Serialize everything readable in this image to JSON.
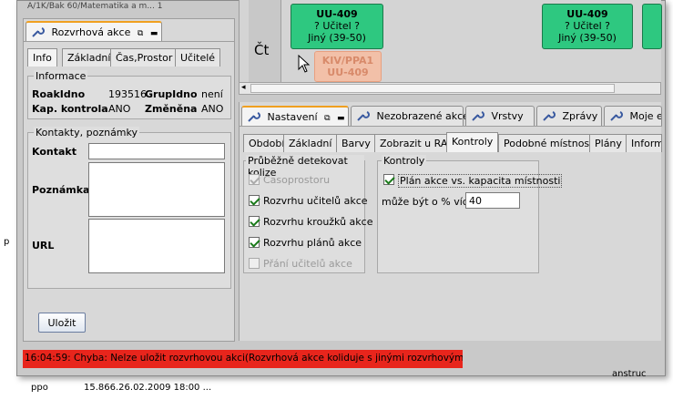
{
  "background": {
    "top_left_fragment": "A/1K/Bak 60/Matematika a m... 1",
    "left_fragment": "p",
    "right_fragment": "anstruc",
    "bottom_fragment": "15.866.26.02.2009 18:00 ...",
    "bottom_left_fragment": "ppo"
  },
  "left_panel": {
    "main_tab": "Rozvrhová akce",
    "tabs": [
      "Info",
      "Základní",
      "Čas,Prostor",
      "Učitelé"
    ],
    "info_group": {
      "title": "Informace",
      "roakidno_label": "RoakIdno",
      "roakidno_value": "193516",
      "grupidno_label": "GrupIdno",
      "grupidno_value": "není",
      "kap_label": "Kap. kontrola",
      "kap_value": "ANO",
      "zmenena_label": "Změněna",
      "zmenena_value": "ANO"
    },
    "contacts_group": {
      "title": "Kontakty, poznámky",
      "kontakt_label": "Kontakt",
      "poznamka_label": "Poznámka",
      "url_label": "URL"
    },
    "save_button": "Uložit"
  },
  "schedule": {
    "day_label": "Čt",
    "event1": {
      "room": "UU-409",
      "teacher": "? Učitel ?",
      "type": "Jiný (39-50)"
    },
    "event2": {
      "room": "UU-409",
      "teacher": "? Učitel ?",
      "type": "Jiný (39-50)"
    },
    "ghost_event": {
      "code": "KIV/PPA1",
      "room": "UU-409"
    }
  },
  "right_panel": {
    "main_tabs": [
      "Nastavení",
      "Nezobrazené akce",
      "Vrstvy",
      "Zprávy",
      "Moje en"
    ],
    "sub_tabs": [
      "Období",
      "Základní",
      "Barvy",
      "Zobrazit u RA",
      "Kontroly",
      "Podobné místnosti",
      "Plány",
      "Inform"
    ],
    "collision_group": {
      "title": "Průběžně detekovat kolize",
      "items": [
        {
          "label": "Časoprostoru",
          "checked": true,
          "disabled": true
        },
        {
          "label": "Rozvrhu učitelů akce",
          "checked": true,
          "disabled": false
        },
        {
          "label": "Rozvrhu kroužků akce",
          "checked": true,
          "disabled": false
        },
        {
          "label": "Rozvrhu plánů akce",
          "checked": true,
          "disabled": false
        },
        {
          "label": "Přání učitelů akce",
          "checked": false,
          "disabled": true
        }
      ]
    },
    "controls_group": {
      "title": "Kontroly",
      "plan_label": "Plán akce vs. kapacita místnosti",
      "percent_label": "může být o % víc",
      "percent_value": "40"
    }
  },
  "status_bar": {
    "message": "16:04:59: Chyba: Nelze uložit rozvrhovou akci(Rozvrhová akce koliduje s jinými rozvrhovými akcemi)"
  },
  "colors": {
    "event_green": "#2ec880",
    "error_red": "#e8251c",
    "tab_accent": "#f0a020"
  }
}
